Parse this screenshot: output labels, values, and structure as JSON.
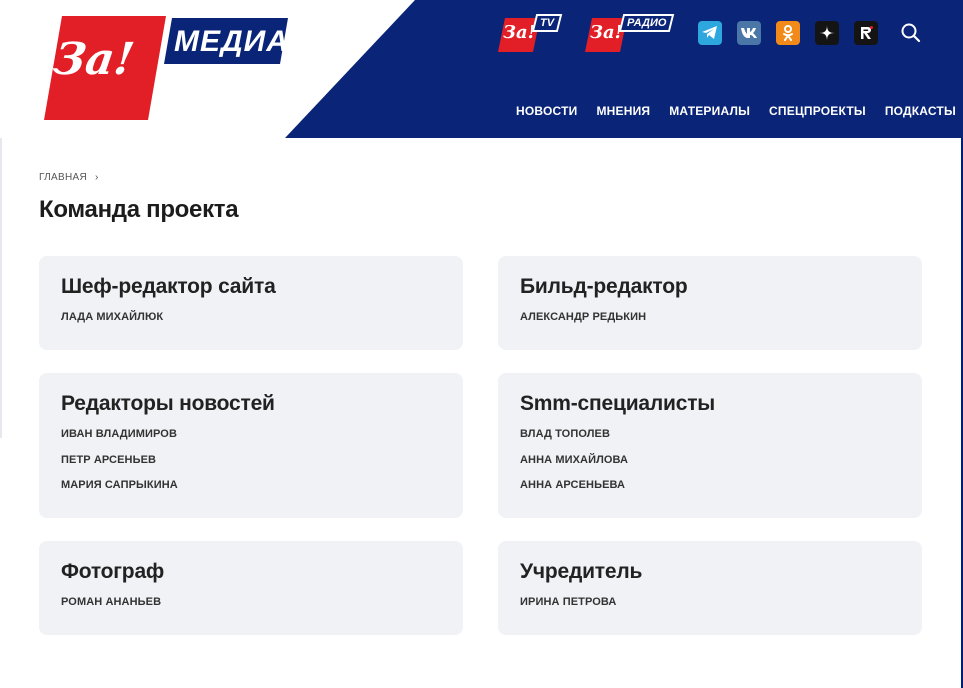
{
  "brand": {
    "logo_mark": "За!",
    "logo_text": "МЕДИА",
    "tv_mark": "За!",
    "tv_label": "TV",
    "radio_mark": "За!",
    "radio_label": "РАДИО",
    "colors": {
      "red": "#e21f26",
      "navy": "#0a2578"
    }
  },
  "social": [
    {
      "icon": "telegram-icon",
      "color": "#2ea6de"
    },
    {
      "icon": "vk-icon",
      "color": "#4a76a8"
    },
    {
      "icon": "odnoklassniki-icon",
      "color": "#f28a1a"
    },
    {
      "icon": "dzen-icon",
      "color": "#141414"
    },
    {
      "icon": "rutube-icon",
      "color": "#141414"
    }
  ],
  "nav": {
    "items": [
      "НОВОСТИ",
      "МНЕНИЯ",
      "МАТЕРИАЛЫ",
      "СПЕЦПРОЕКТЫ",
      "ПОДКАСТЫ"
    ]
  },
  "breadcrumb": {
    "home": "ГЛАВНАЯ",
    "separator": "›"
  },
  "page_title": "Команда проекта",
  "cards": [
    {
      "title": "Шеф-редактор сайта",
      "people": [
        "ЛАДА МИХАЙЛЮК"
      ]
    },
    {
      "title": "Бильд-редактор",
      "people": [
        "АЛЕКСАНДР РЕДЬКИН"
      ]
    },
    {
      "title": "Редакторы новостей",
      "people": [
        "ИВАН ВЛАДИМИРОВ",
        "ПЕТР АРСЕНЬЕВ",
        "МАРИЯ САПРЫКИНА"
      ]
    },
    {
      "title": "Smm-специалисты",
      "people": [
        "ВЛАД ТОПОЛЕВ",
        "АННА МИХАЙЛОВА",
        "АННА АРСЕНЬЕВА"
      ]
    },
    {
      "title": "Фотограф",
      "people": [
        "РОМАН АНАНЬЕВ"
      ]
    },
    {
      "title": "Учредитель",
      "people": [
        "ИРИНА ПЕТРОВА"
      ]
    }
  ]
}
